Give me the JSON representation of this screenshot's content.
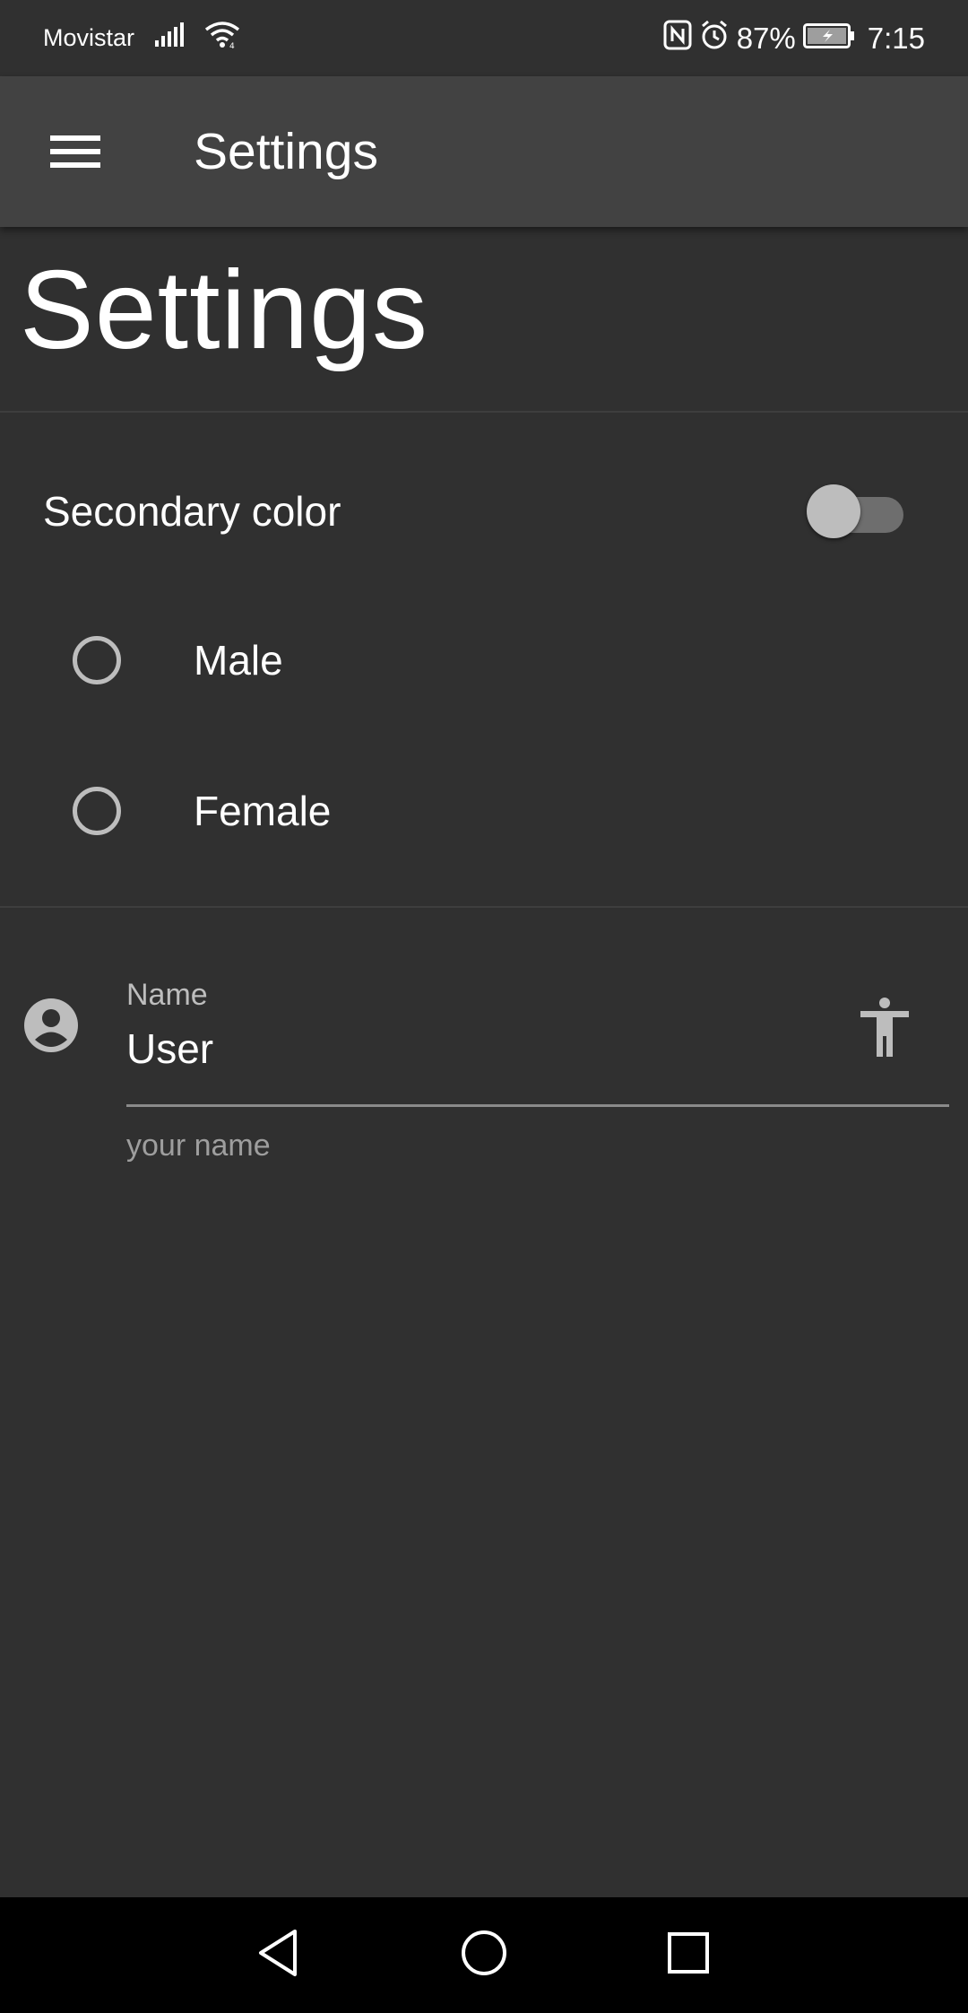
{
  "status_bar": {
    "carrier": "Movistar",
    "battery_percent": "87%",
    "time": "7:15",
    "icons": [
      "signal-icon",
      "wifi-icon",
      "nfc-icon",
      "alarm-icon",
      "battery-charging-icon"
    ]
  },
  "app_bar": {
    "menu_icon": "hamburger-menu-icon",
    "title": "Settings"
  },
  "page": {
    "heading": "Settings"
  },
  "switch_setting": {
    "label": "Secondary color",
    "checked": false
  },
  "gender_radio": {
    "options": [
      {
        "label": "Male",
        "selected": false
      },
      {
        "label": "Female",
        "selected": false
      }
    ]
  },
  "name_field": {
    "label": "Name",
    "value": "User",
    "helper": "your name",
    "leading_icon": "account-circle-icon",
    "trailing_icon": "accessibility-icon"
  },
  "nav_bar": {
    "buttons": [
      "back-icon",
      "home-icon",
      "recents-icon"
    ]
  },
  "colors": {
    "background": "#303030",
    "app_bar": "#424242",
    "switch_thumb": "#bdbdbd",
    "switch_track": "#6e6e6e",
    "helper_text": "#9e9e9e"
  }
}
